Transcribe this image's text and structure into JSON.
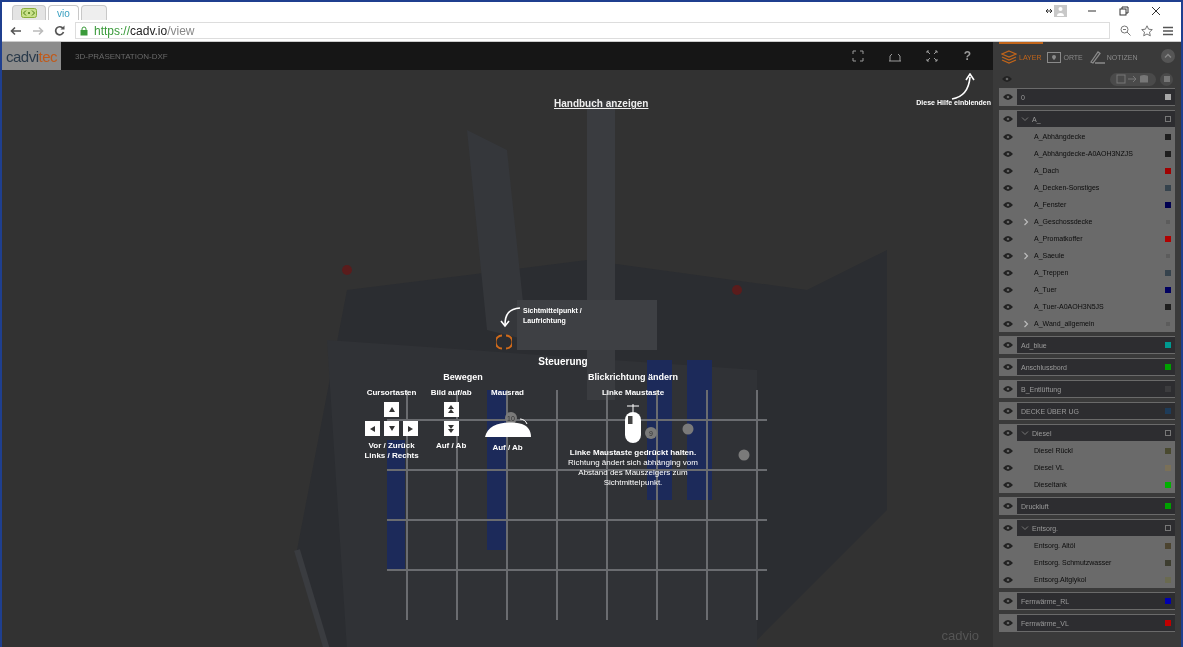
{
  "browser": {
    "tabs": [
      {
        "selected": false,
        "kind": "icon"
      },
      {
        "label": "vio",
        "selected": true,
        "kind": "text"
      },
      {
        "selected": false,
        "kind": "new"
      }
    ],
    "url": {
      "scheme": "https://",
      "host": "cadv.io",
      "path": "/view"
    }
  },
  "app": {
    "logo": {
      "main": "cadvi",
      "accent": "tec"
    },
    "title": "3D-PRÄSENTATION-DXF",
    "help_button": "?"
  },
  "viewport": {
    "manual_link": "Handbuch anzeigen",
    "help_hint": "Diese Hilfe einblenden",
    "pivot_hint": [
      "Sichtmittelpunkt /",
      "Laufrichtung"
    ],
    "markers": [
      "10",
      "9"
    ],
    "logo": "cadvio",
    "help": {
      "title": "Steuerung",
      "move": {
        "title": "Bewegen",
        "keys": {
          "label": "Cursortasten",
          "caption": [
            "Vor / Zurück",
            "Links / Rechts"
          ]
        },
        "page": {
          "label": "Bild auf/ab",
          "caption": "Auf / Ab"
        },
        "wheel": {
          "label": "Mausrad",
          "caption": "Auf / Ab"
        }
      },
      "look": {
        "title": "Blickrichtung ändern",
        "label": "Linke Maustaste",
        "text": "**Linke Maustaste gedrückt halten.** Richtung ändert sich abhänging vom Abstand des Mauszeigers zum Sichtmittelpunkt."
      }
    }
  },
  "panel": {
    "tabs": [
      {
        "label": "LAYER",
        "selected": true
      },
      {
        "label": "ORTE",
        "selected": false
      },
      {
        "label": "NOTIZEN",
        "selected": false
      }
    ],
    "layers": [
      {
        "name": "0",
        "kind": "layer",
        "color": "#a8a8a8"
      },
      {
        "name": "A_",
        "kind": "folder",
        "expanded": true,
        "children": [
          {
            "name": "A_Abhängdecke",
            "kind": "layer",
            "color": "#1e1e1e"
          },
          {
            "name": "A_Abhängdecke-A0AOH3NZJS",
            "kind": "layer",
            "color": "#1e1e1e"
          },
          {
            "name": "A_Dach",
            "kind": "layer",
            "color": "#a00000"
          },
          {
            "name": "A_Decken-Sonstiges",
            "kind": "layer",
            "color": "#36434d"
          },
          {
            "name": "A_Fenster",
            "kind": "layer",
            "color": "#000050"
          },
          {
            "name": "A_Geschossdecke",
            "kind": "folder",
            "expanded": false
          },
          {
            "name": "A_Promatkoffer",
            "kind": "layer",
            "color": "#b00000"
          },
          {
            "name": "A_Saeule",
            "kind": "folder",
            "expanded": false
          },
          {
            "name": "A_Treppen",
            "kind": "layer",
            "color": "#36434d"
          },
          {
            "name": "A_Tuer",
            "kind": "layer",
            "color": "#000060"
          },
          {
            "name": "A_Tuer-A0AOH3N5JS",
            "kind": "layer",
            "color": "#1e1e1e"
          },
          {
            "name": "A_Wand_allgemein",
            "kind": "folder",
            "expanded": false
          }
        ]
      },
      {
        "name": "Ad_blue",
        "kind": "layer",
        "color": "#009a90"
      },
      {
        "name": "Anschlussbord",
        "kind": "layer",
        "color": "#00a000"
      },
      {
        "name": "B_Entlüftung",
        "kind": "layer",
        "color": "#3c3c3e"
      },
      {
        "name": "DECKE ÜBER UG",
        "kind": "layer",
        "color": "#1e3c5a"
      },
      {
        "name": "Diesel",
        "kind": "folder",
        "expanded": true,
        "children": [
          {
            "name": "Diesel Rückl",
            "kind": "layer",
            "color": "#4a4a30"
          },
          {
            "name": "Diesel VL",
            "kind": "layer",
            "color": "#7a7058"
          },
          {
            "name": "Dieseltank",
            "kind": "layer",
            "color": "#00b000"
          }
        ]
      },
      {
        "name": "Druckluft",
        "kind": "layer",
        "color": "#00a000"
      },
      {
        "name": "Entsorg.",
        "kind": "folder",
        "expanded": true,
        "children": [
          {
            "name": "Entsorg. Altöl",
            "kind": "layer",
            "color": "#4c4430"
          },
          {
            "name": "Entsorg. Schmutzwasser",
            "kind": "layer",
            "color": "#3e3e30"
          },
          {
            "name": "Entsorg.Altglykol",
            "kind": "layer",
            "color": "#6a6a50"
          }
        ]
      },
      {
        "name": "Fernwärme_RL",
        "kind": "layer",
        "color": "#0000b0"
      },
      {
        "name": "Fernwärme_VL",
        "kind": "layer",
        "color": "#c00000"
      }
    ]
  }
}
